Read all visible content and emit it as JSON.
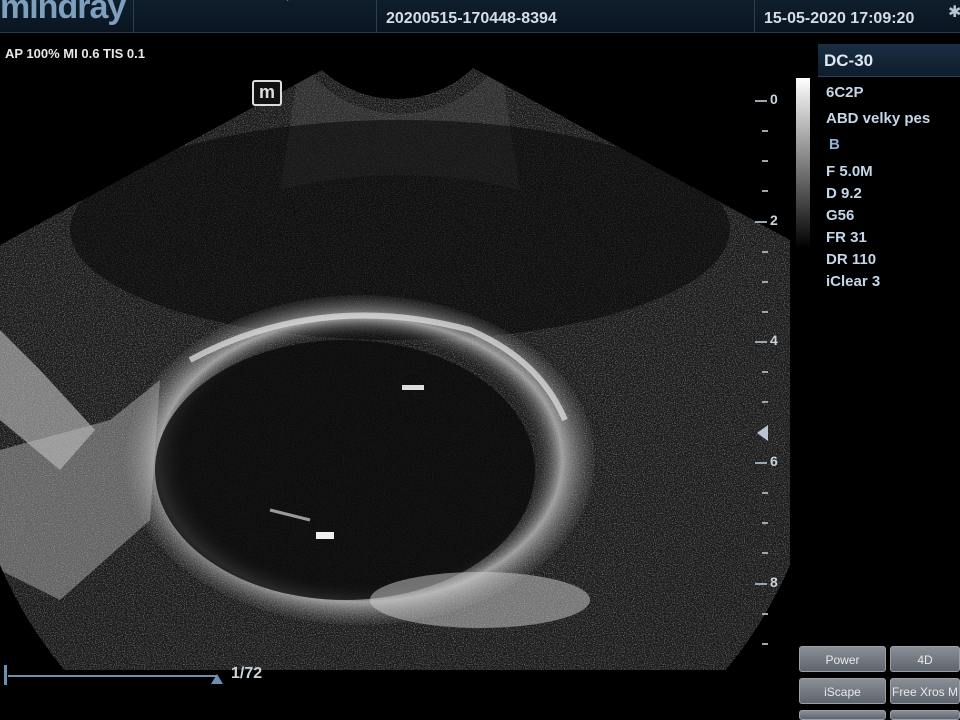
{
  "header": {
    "brand": "mindray",
    "exam_id": "20200515-170448-8394",
    "datetime": "15-05-2020  17:09:20"
  },
  "acoustic": {
    "text": "AP 100%  MI 0.6 TIS 0.1"
  },
  "probe_logo": "m",
  "depth_scale": {
    "labels": [
      "0",
      "2",
      "4",
      "6",
      "8"
    ],
    "unit_hint": "cm"
  },
  "right_panel": {
    "preset": "DC-30",
    "probe": "6C2P",
    "exam_type": "ABD velky pes",
    "mode": "B",
    "params": [
      "F 5.0M",
      "D 9.2",
      "G56",
      "FR 31",
      "DR 110",
      "iClear 3"
    ]
  },
  "cine": {
    "counter": "1/72",
    "progress": 1.0
  },
  "soft_buttons": {
    "power": "Power",
    "four_d": "4D",
    "iscape": "iScape",
    "free_xros": "Free Xros M"
  },
  "colors": {
    "accent": "#6d8fb0",
    "panel_bg": "#0f1d2c",
    "text_blue": "#c4d6e8"
  }
}
